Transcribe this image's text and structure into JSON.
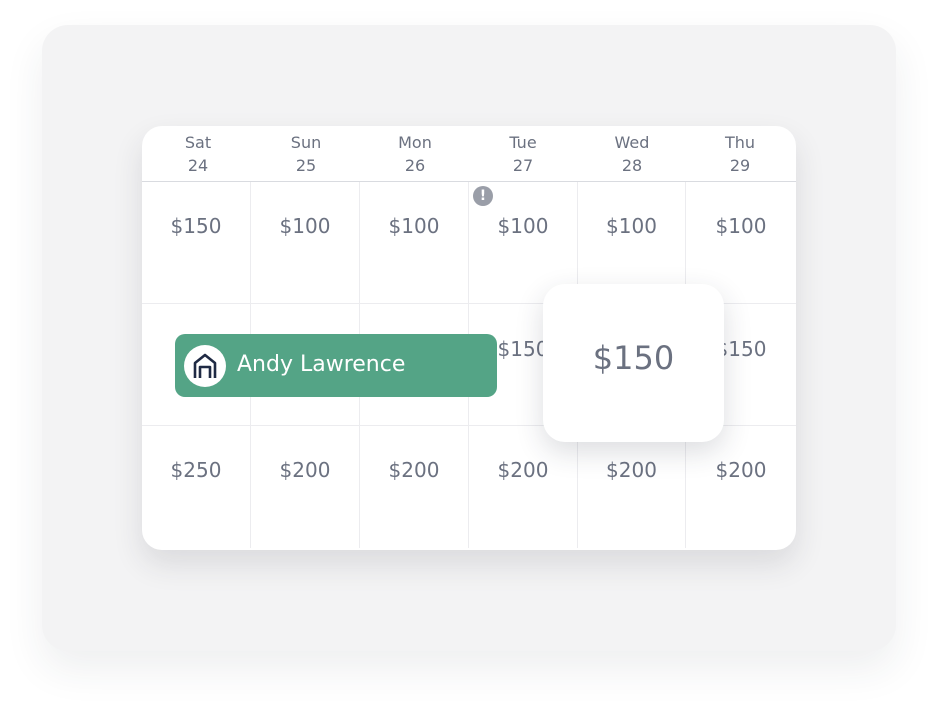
{
  "days": [
    {
      "name": "Sat",
      "date": "24"
    },
    {
      "name": "Sun",
      "date": "25"
    },
    {
      "name": "Mon",
      "date": "26"
    },
    {
      "name": "Tue",
      "date": "27"
    },
    {
      "name": "Wed",
      "date": "28"
    },
    {
      "name": "Thu",
      "date": "29"
    }
  ],
  "rows": [
    [
      "$150",
      "$100",
      "$100",
      "$100",
      "$100",
      "$100"
    ],
    [
      "",
      "",
      "",
      "$150",
      "",
      "$150"
    ],
    [
      "$250",
      "$200",
      "$200",
      "$200",
      "$200",
      "$200"
    ]
  ],
  "alert": {
    "symbol": "!",
    "icon": "exclamation-icon"
  },
  "booking": {
    "guest": "Andy Lawrence",
    "icon": "house-icon",
    "color": "#54a486"
  },
  "popup": {
    "price": "$150"
  },
  "colors": {
    "text": "#6b7180",
    "backdrop": "#f3f3f4",
    "grid": "#ececef"
  }
}
